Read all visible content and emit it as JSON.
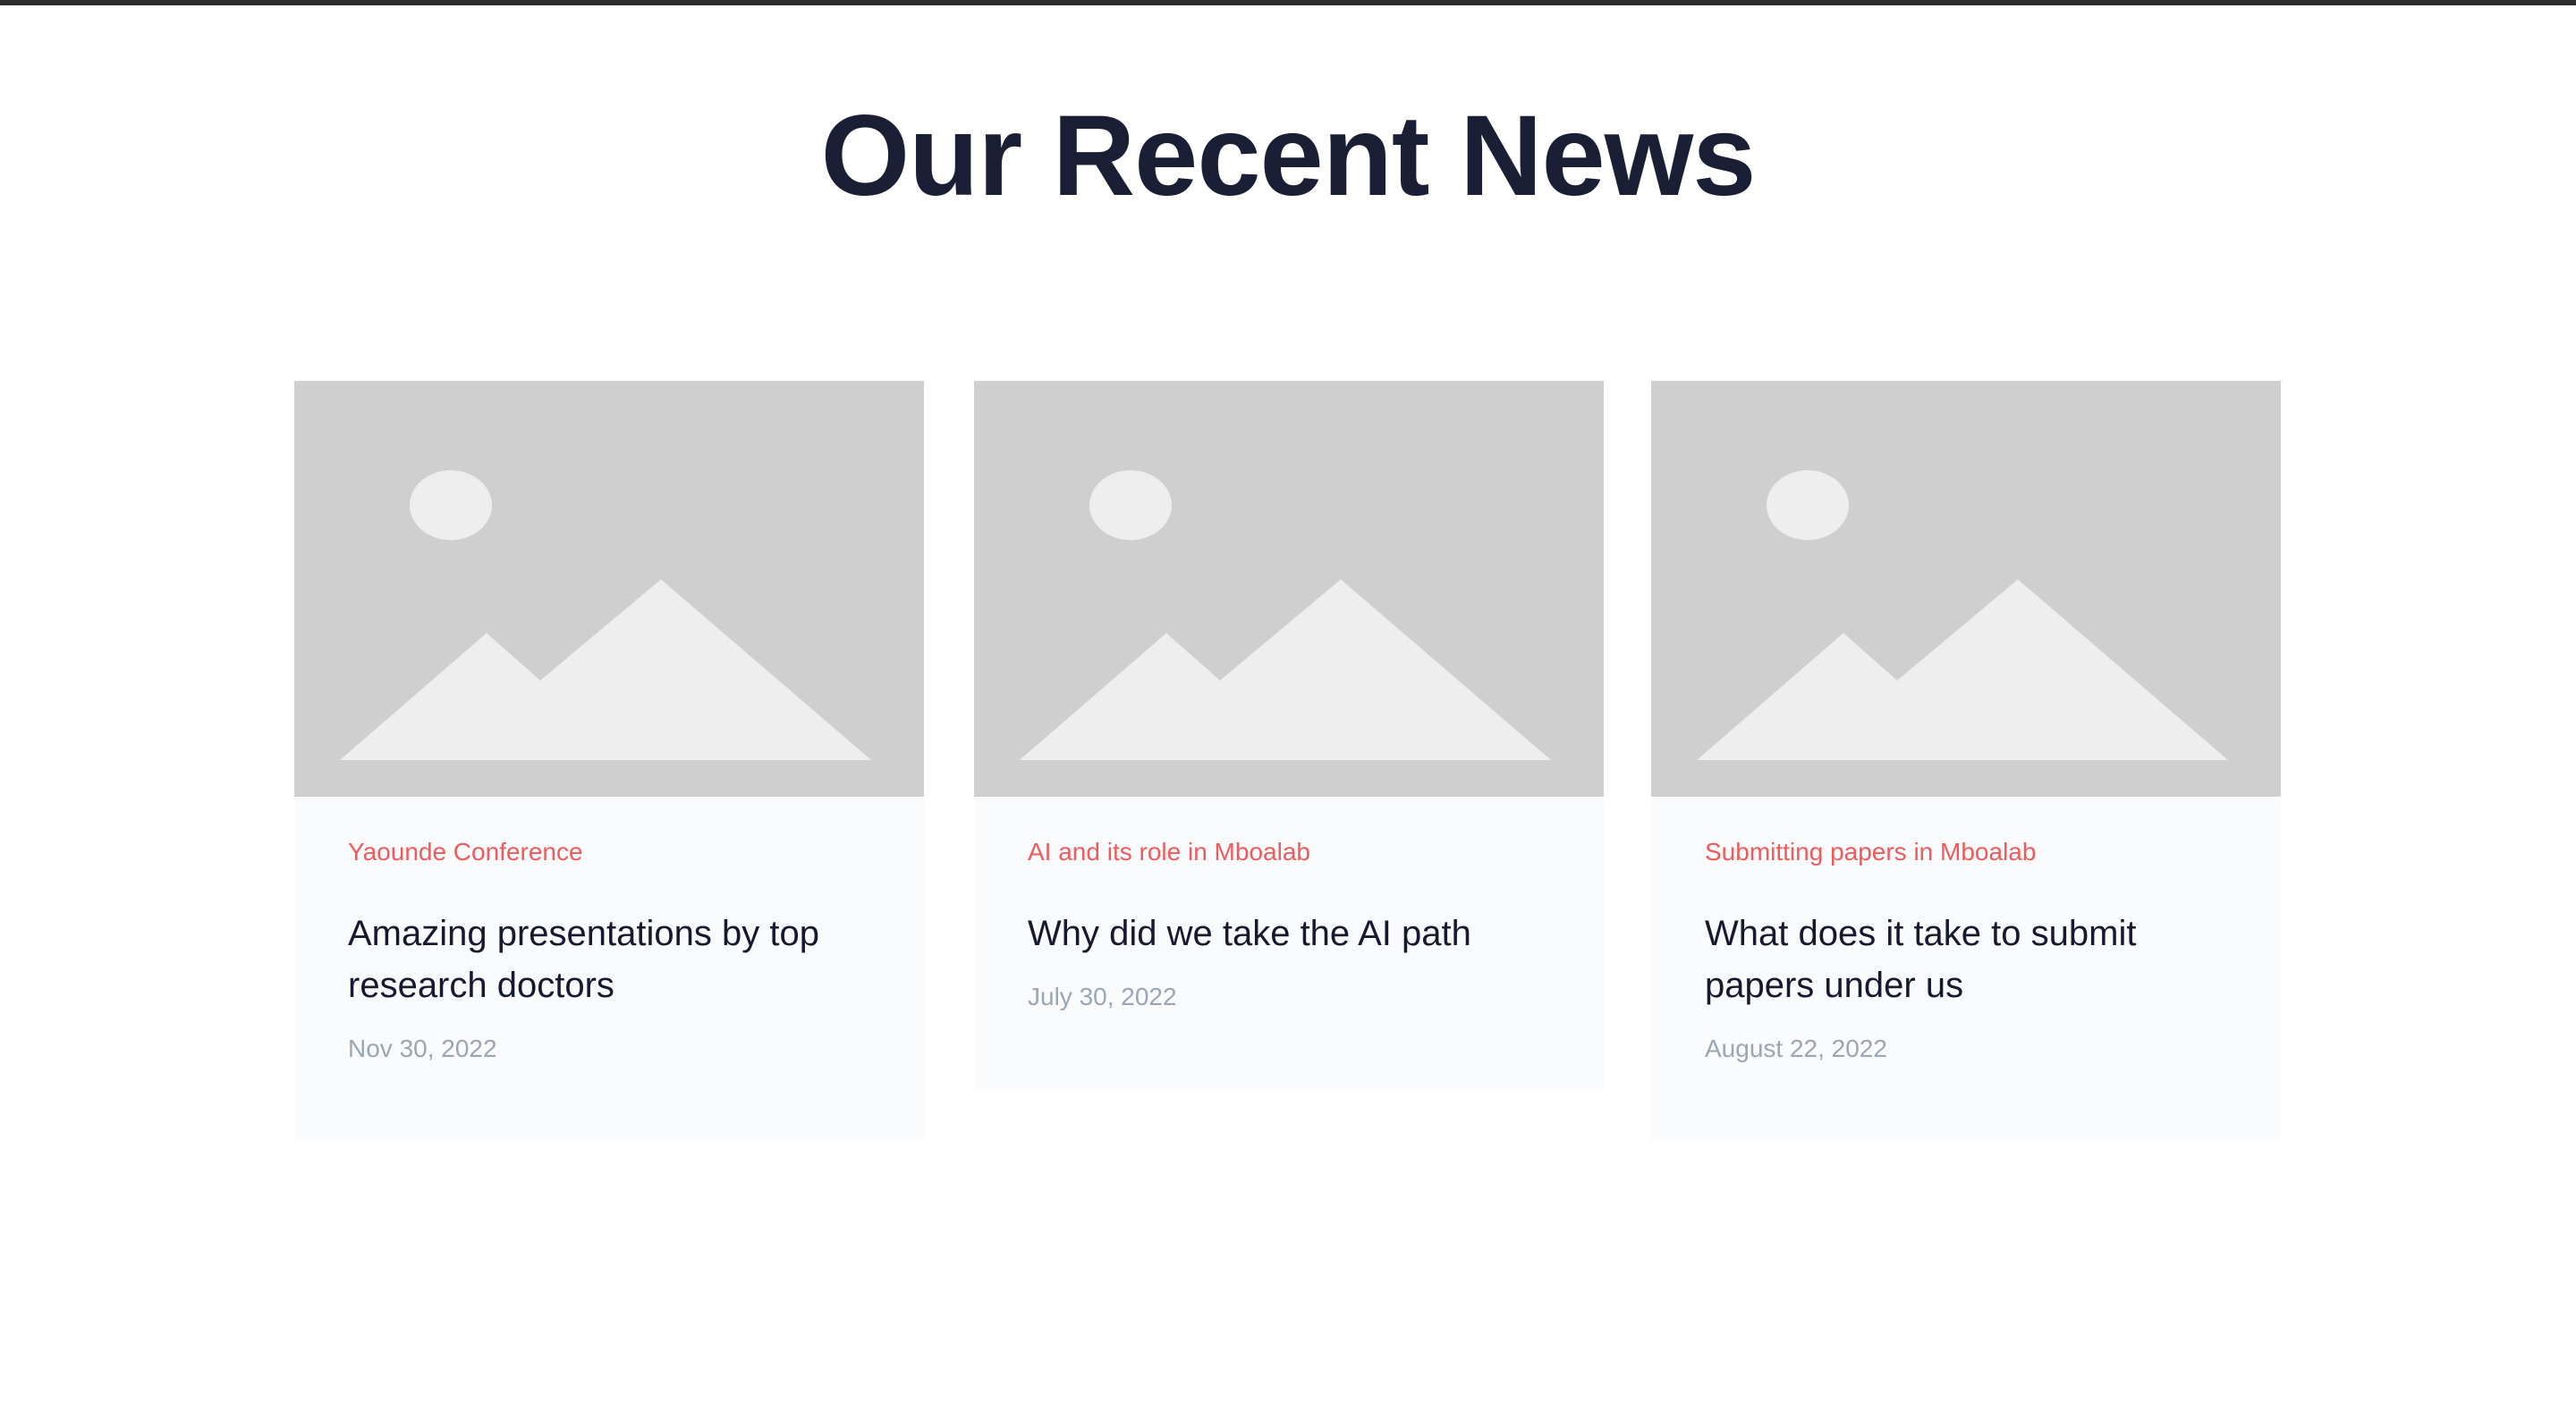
{
  "section": {
    "title": "Our Recent News"
  },
  "colors": {
    "title": "#1a1f36",
    "category": "#f05a5a",
    "date": "#9aa5b5",
    "placeholder_bg": "#cfcfcf",
    "placeholder_fg": "#eeeeee",
    "card_bg": "#fafbfd"
  },
  "news": [
    {
      "image_icon": "image-placeholder-icon",
      "category": "Yaounde Conference",
      "headline": "Amazing presentations by top research doctors",
      "date": "Nov 30, 2022"
    },
    {
      "image_icon": "image-placeholder-icon",
      "category": "AI and its role in Mboalab",
      "headline": "Why did we take the AI path",
      "date": "July 30, 2022"
    },
    {
      "image_icon": "image-placeholder-icon",
      "category": "Submitting papers in Mboalab",
      "headline": "What does it take to submit papers under us",
      "date": "August 22, 2022"
    }
  ]
}
